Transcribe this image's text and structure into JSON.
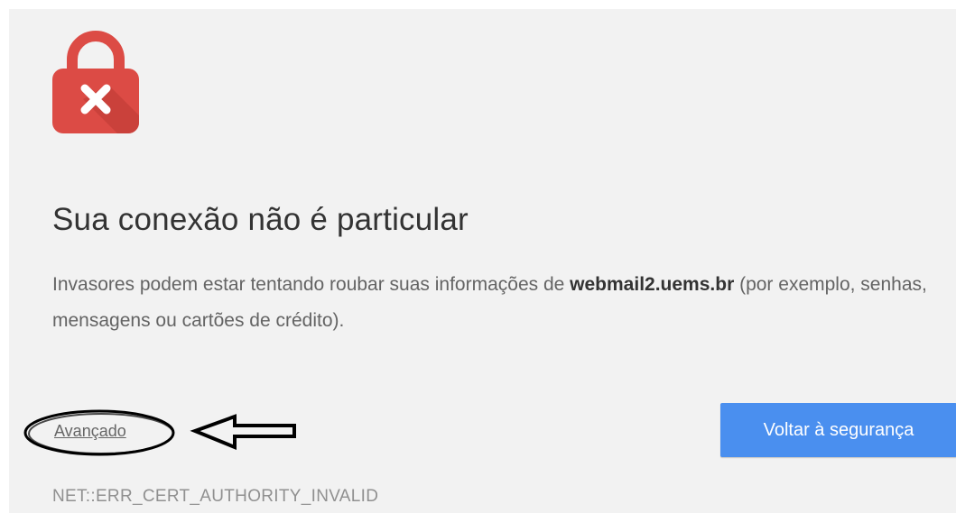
{
  "icon": "lock-error-icon",
  "colors": {
    "lock": "#dc4b45",
    "button": "#4a8fef",
    "background": "#f2f2f2"
  },
  "main": {
    "title": "Sua conexão não é particular",
    "description_before": "Invasores podem estar tentando roubar suas informações de ",
    "domain": "webmail2.uems.br",
    "description_after": " (por exemplo, senhas, mensagens ou cartões de crédito).",
    "advanced_label": "Avançado",
    "back_button_label": "Voltar à segurança",
    "error_code": "NET::ERR_CERT_AUTHORITY_INVALID"
  }
}
